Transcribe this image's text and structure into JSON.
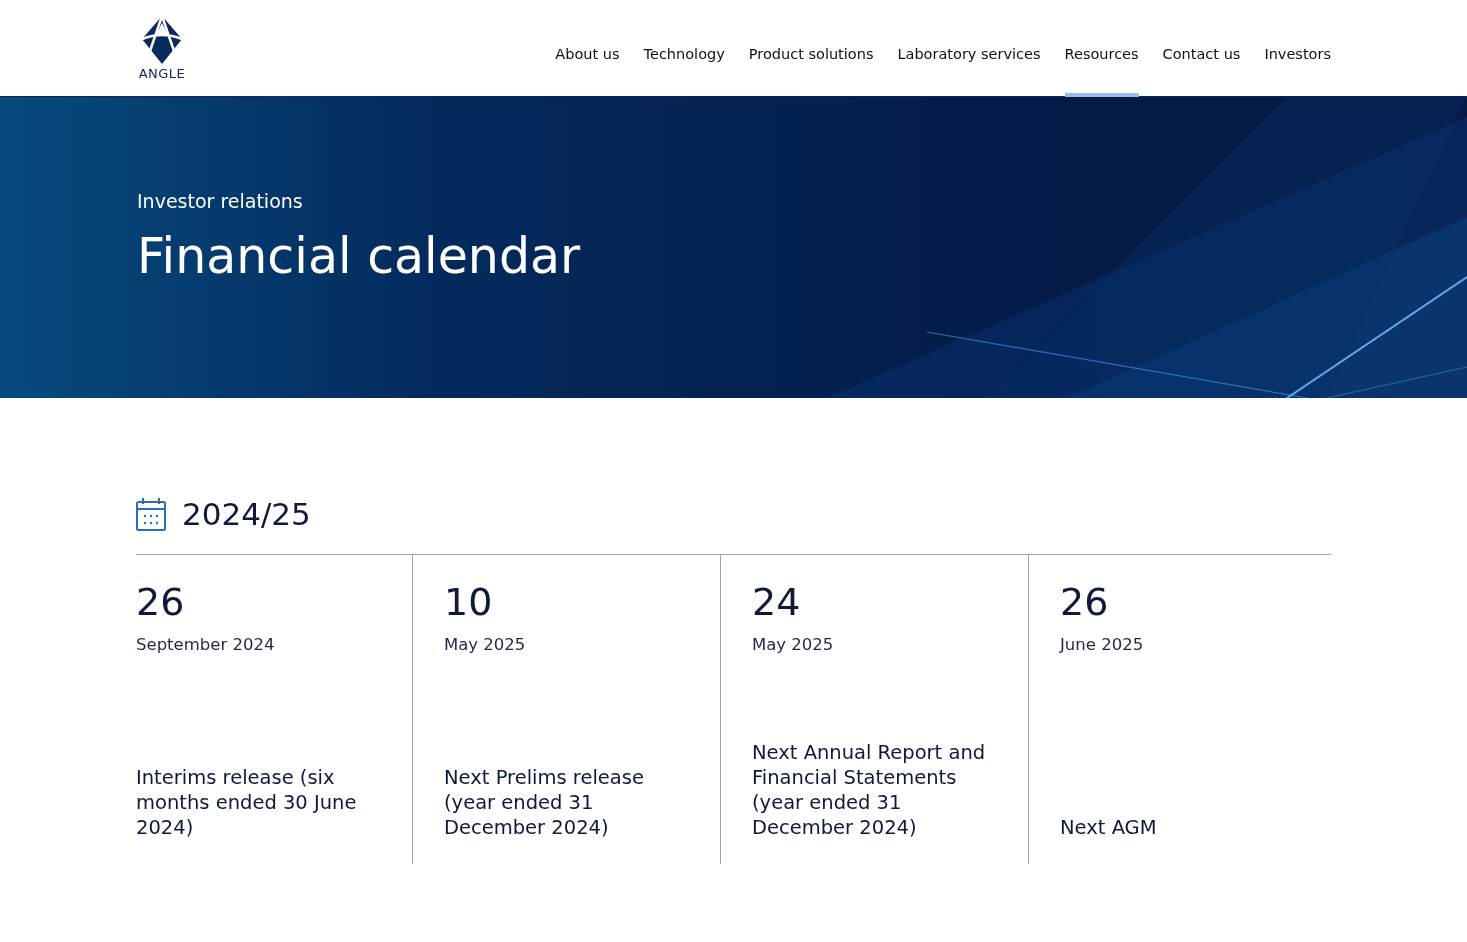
{
  "logo": {
    "text": "ANGLE"
  },
  "nav": [
    {
      "label": "About us",
      "selected": false
    },
    {
      "label": "Technology",
      "selected": false
    },
    {
      "label": "Product solutions",
      "selected": false
    },
    {
      "label": "Laboratory services",
      "selected": false
    },
    {
      "label": "Resources",
      "selected": true
    },
    {
      "label": "Contact us",
      "selected": false
    },
    {
      "label": "Investors",
      "selected": false
    }
  ],
  "hero": {
    "eyebrow": "Investor relations",
    "title": "Financial calendar"
  },
  "section": {
    "heading": "2024/25"
  },
  "events": [
    {
      "day": "26",
      "month": "September 2024",
      "description": "Interims release (six months ended 30 June 2024)"
    },
    {
      "day": "10",
      "month": "May 2025",
      "description": "Next Prelims release (year ended 31 December 2024)"
    },
    {
      "day": "24",
      "month": "May 2025",
      "description": "Next Annual Report and Financial Statements (year ended 31 December 2024)"
    },
    {
      "day": "26",
      "month": "June 2025",
      "description": "Next AGM"
    }
  ]
}
